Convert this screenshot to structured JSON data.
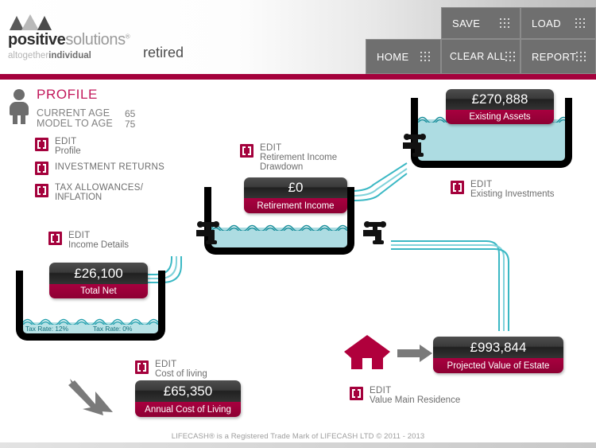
{
  "header": {
    "logo_word_bold": "positive",
    "logo_word_light": "solutions",
    "logo_reg": "®",
    "logo_sub_light": "altogether",
    "logo_sub_bold": "individual",
    "page_name": "retired"
  },
  "nav": {
    "save": "SAVE",
    "load": "LOAD",
    "home": "HOME",
    "clear_all": "CLEAR ALL",
    "report": "REPORT"
  },
  "profile": {
    "title": "PROFILE",
    "current_age_label": "CURRENT AGE",
    "current_age_value": "65",
    "model_to_age_label": "MODEL TO AGE",
    "model_to_age_value": "75"
  },
  "edits": {
    "profile": {
      "line1": "EDIT",
      "line2": "Profile"
    },
    "investment_returns": {
      "line1": "INVESTMENT RETURNS",
      "line2": ""
    },
    "tax_allowances": {
      "line1": "TAX ALLOWANCES/",
      "line2": "INFLATION"
    },
    "income_details": {
      "line1": "EDIT",
      "line2": "Income Details"
    },
    "retirement_income_drawdown": {
      "line1": "EDIT",
      "line2": "Retirement Income\nDrawdown"
    },
    "existing_investments": {
      "line1": "EDIT",
      "line2": "Existing Investments"
    },
    "cost_of_living": {
      "line1": "EDIT",
      "line2": "Cost of living"
    },
    "value_main_residence": {
      "line1": "EDIT",
      "line2": "Value Main Residence"
    }
  },
  "plaques": {
    "existing_assets": {
      "value": "£270,888",
      "label": "Existing Assets"
    },
    "retirement_income": {
      "value": "£0",
      "label": "Retirement Income"
    },
    "total_net": {
      "value": "£26,100",
      "label": "Total Net"
    },
    "annual_cost_of_living": {
      "value": "£65,350",
      "label": "Annual Cost of Living"
    },
    "projected_value_of_estate": {
      "value": "£993,844",
      "label": "Projected Value of Estate"
    }
  },
  "tank_labels": {
    "tax_rate_left": "Tax Rate: 12%",
    "tax_rate_right": "Tax Rate: 0%"
  },
  "footer": {
    "text": "LIFECASH® is a Registered Trade Mark of LIFECASH LTD © 2011 - 2013"
  },
  "colors": {
    "brand_crimson": "#a4013c",
    "profile_pink": "#c2185b",
    "nav_grey": "#6f6f6f",
    "water_blue": "#addce2",
    "pipe_teal": "#16a3b0",
    "tank_black": "#000000",
    "arrow_grey": "#7a7a7a",
    "house_crimson": "#b0003c"
  }
}
